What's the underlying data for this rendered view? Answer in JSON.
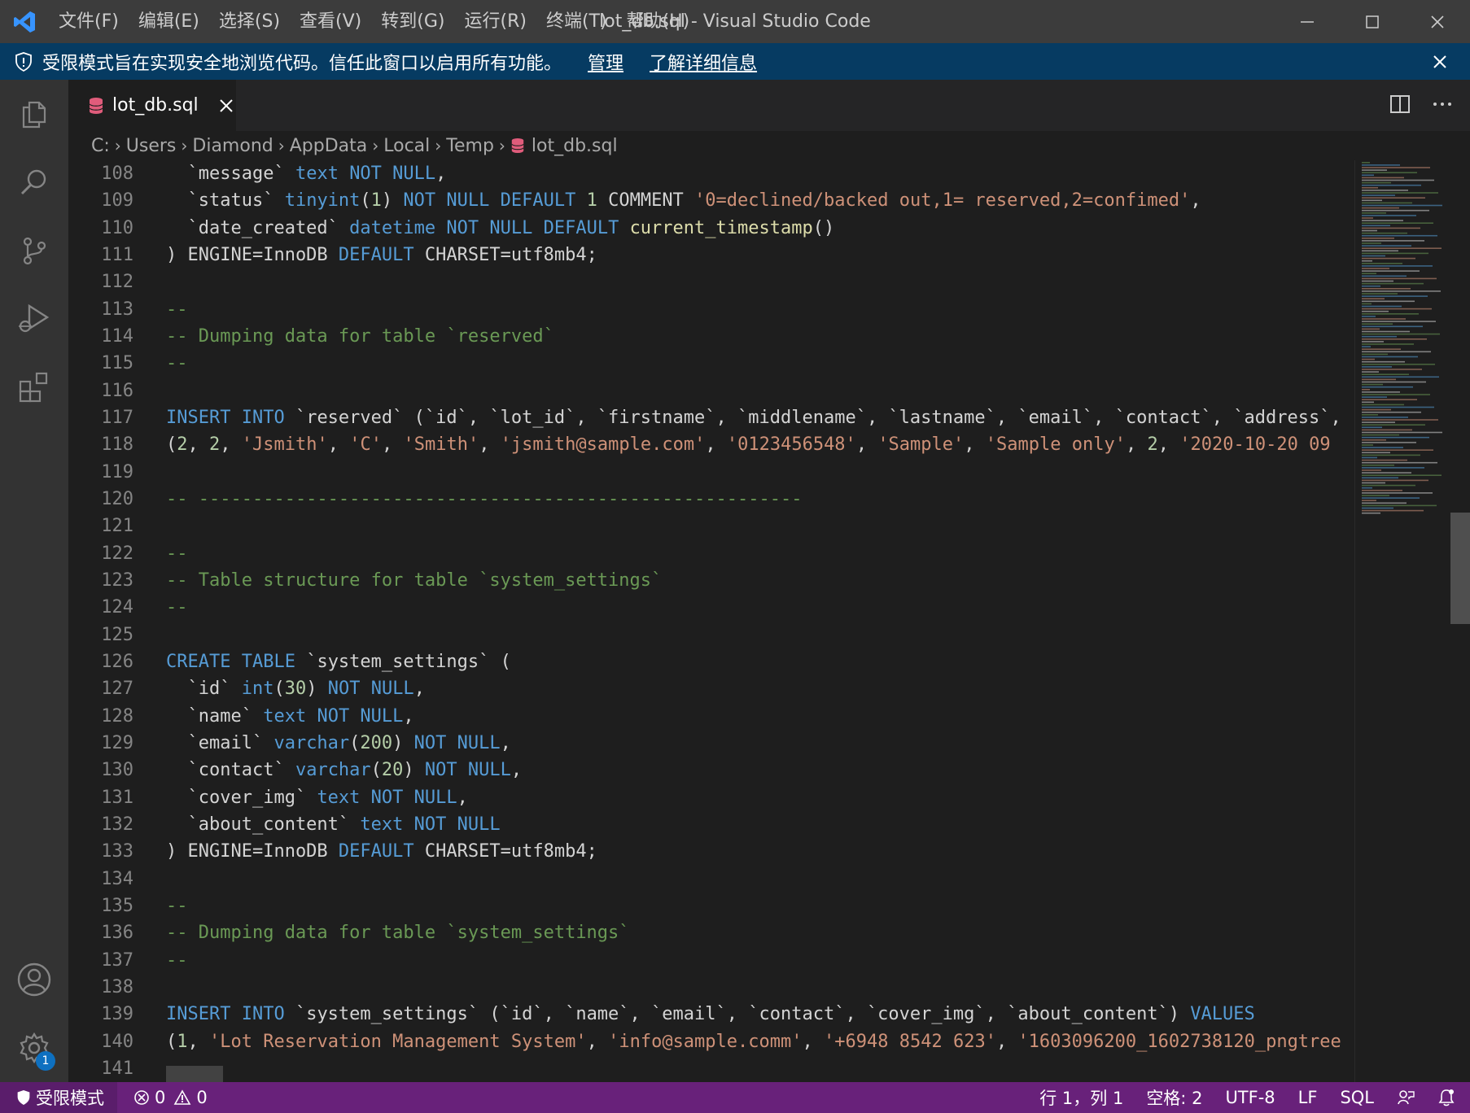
{
  "window": {
    "title": "lot_db.sql - Visual Studio Code",
    "menu": [
      "文件(F)",
      "编辑(E)",
      "选择(S)",
      "查看(V)",
      "转到(G)",
      "运行(R)",
      "终端(T)",
      "帮助(H)"
    ]
  },
  "banner": {
    "text": "受限模式旨在实现安全地浏览代码。信任此窗口以启用所有功能。",
    "manage_link": "管理",
    "learn_more_link": "了解详细信息"
  },
  "tab": {
    "label": "lot_db.sql"
  },
  "breadcrumb": [
    "C:",
    "Users",
    "Diamond",
    "AppData",
    "Local",
    "Temp",
    "lot_db.sql"
  ],
  "editor": {
    "lines": [
      {
        "n": "108",
        "t": [
          [
            "plain",
            "  `message` "
          ],
          [
            "kw",
            "text"
          ],
          [
            "plain",
            " "
          ],
          [
            "kw",
            "NOT NULL"
          ],
          [
            "plain",
            ","
          ]
        ]
      },
      {
        "n": "109",
        "t": [
          [
            "plain",
            "  `status` "
          ],
          [
            "kw",
            "tinyint"
          ],
          [
            "plain",
            "("
          ],
          [
            "num",
            "1"
          ],
          [
            "plain",
            ") "
          ],
          [
            "kw",
            "NOT NULL DEFAULT"
          ],
          [
            "plain",
            " "
          ],
          [
            "num",
            "1"
          ],
          [
            "plain",
            " COMMENT "
          ],
          [
            "str",
            "'0=declined/backed out,1= reserved,2=confimed'"
          ],
          [
            "plain",
            ","
          ]
        ]
      },
      {
        "n": "110",
        "t": [
          [
            "plain",
            "  `date_created` "
          ],
          [
            "kw",
            "datetime"
          ],
          [
            "plain",
            " "
          ],
          [
            "kw",
            "NOT NULL DEFAULT"
          ],
          [
            "plain",
            " "
          ],
          [
            "fn",
            "current_timestamp"
          ],
          [
            "plain",
            "()"
          ]
        ]
      },
      {
        "n": "111",
        "t": [
          [
            "plain",
            ") ENGINE=InnoDB "
          ],
          [
            "kw",
            "DEFAULT"
          ],
          [
            "plain",
            " CHARSET=utf8mb4;"
          ]
        ]
      },
      {
        "n": "112",
        "t": []
      },
      {
        "n": "113",
        "t": [
          [
            "cmt",
            "--"
          ]
        ]
      },
      {
        "n": "114",
        "t": [
          [
            "cmt",
            "-- Dumping data for table `reserved`"
          ]
        ]
      },
      {
        "n": "115",
        "t": [
          [
            "cmt",
            "--"
          ]
        ]
      },
      {
        "n": "116",
        "t": []
      },
      {
        "n": "117",
        "t": [
          [
            "kw",
            "INSERT INTO"
          ],
          [
            "plain",
            " `reserved` (`id`, `lot_id`, `firstname`, `middlename`, `lastname`, `email`, `contact`, `address`, "
          ]
        ]
      },
      {
        "n": "118",
        "t": [
          [
            "plain",
            "("
          ],
          [
            "num",
            "2"
          ],
          [
            "plain",
            ", "
          ],
          [
            "num",
            "2"
          ],
          [
            "plain",
            ", "
          ],
          [
            "str",
            "'Jsmith'"
          ],
          [
            "plain",
            ", "
          ],
          [
            "str",
            "'C'"
          ],
          [
            "plain",
            ", "
          ],
          [
            "str",
            "'Smith'"
          ],
          [
            "plain",
            ", "
          ],
          [
            "str",
            "'jsmith@sample.com'"
          ],
          [
            "plain",
            ", "
          ],
          [
            "str",
            "'0123456548'"
          ],
          [
            "plain",
            ", "
          ],
          [
            "str",
            "'Sample'"
          ],
          [
            "plain",
            ", "
          ],
          [
            "str",
            "'Sample only'"
          ],
          [
            "plain",
            ", "
          ],
          [
            "num",
            "2"
          ],
          [
            "plain",
            ", "
          ],
          [
            "str",
            "'2020-10-20 09"
          ]
        ]
      },
      {
        "n": "119",
        "t": []
      },
      {
        "n": "120",
        "t": [
          [
            "cmt",
            "-- --------------------------------------------------------"
          ]
        ]
      },
      {
        "n": "121",
        "t": []
      },
      {
        "n": "122",
        "t": [
          [
            "cmt",
            "--"
          ]
        ]
      },
      {
        "n": "123",
        "t": [
          [
            "cmt",
            "-- Table structure for table `system_settings`"
          ]
        ]
      },
      {
        "n": "124",
        "t": [
          [
            "cmt",
            "--"
          ]
        ]
      },
      {
        "n": "125",
        "t": []
      },
      {
        "n": "126",
        "t": [
          [
            "kw",
            "CREATE TABLE"
          ],
          [
            "plain",
            " `system_settings` ("
          ]
        ]
      },
      {
        "n": "127",
        "t": [
          [
            "plain",
            "  `id` "
          ],
          [
            "kw",
            "int"
          ],
          [
            "plain",
            "("
          ],
          [
            "num",
            "30"
          ],
          [
            "plain",
            ") "
          ],
          [
            "kw",
            "NOT NULL"
          ],
          [
            "plain",
            ","
          ]
        ]
      },
      {
        "n": "128",
        "t": [
          [
            "plain",
            "  `name` "
          ],
          [
            "kw",
            "text"
          ],
          [
            "plain",
            " "
          ],
          [
            "kw",
            "NOT NULL"
          ],
          [
            "plain",
            ","
          ]
        ]
      },
      {
        "n": "129",
        "t": [
          [
            "plain",
            "  `email` "
          ],
          [
            "kw",
            "varchar"
          ],
          [
            "plain",
            "("
          ],
          [
            "num",
            "200"
          ],
          [
            "plain",
            ") "
          ],
          [
            "kw",
            "NOT NULL"
          ],
          [
            "plain",
            ","
          ]
        ]
      },
      {
        "n": "130",
        "t": [
          [
            "plain",
            "  `contact` "
          ],
          [
            "kw",
            "varchar"
          ],
          [
            "plain",
            "("
          ],
          [
            "num",
            "20"
          ],
          [
            "plain",
            ") "
          ],
          [
            "kw",
            "NOT NULL"
          ],
          [
            "plain",
            ","
          ]
        ]
      },
      {
        "n": "131",
        "t": [
          [
            "plain",
            "  `cover_img` "
          ],
          [
            "kw",
            "text"
          ],
          [
            "plain",
            " "
          ],
          [
            "kw",
            "NOT NULL"
          ],
          [
            "plain",
            ","
          ]
        ]
      },
      {
        "n": "132",
        "t": [
          [
            "plain",
            "  `about_content` "
          ],
          [
            "kw",
            "text"
          ],
          [
            "plain",
            " "
          ],
          [
            "kw",
            "NOT NULL"
          ]
        ]
      },
      {
        "n": "133",
        "t": [
          [
            "plain",
            ") ENGINE=InnoDB "
          ],
          [
            "kw",
            "DEFAULT"
          ],
          [
            "plain",
            " CHARSET=utf8mb4;"
          ]
        ]
      },
      {
        "n": "134",
        "t": []
      },
      {
        "n": "135",
        "t": [
          [
            "cmt",
            "--"
          ]
        ]
      },
      {
        "n": "136",
        "t": [
          [
            "cmt",
            "-- Dumping data for table `system_settings`"
          ]
        ]
      },
      {
        "n": "137",
        "t": [
          [
            "cmt",
            "--"
          ]
        ]
      },
      {
        "n": "138",
        "t": []
      },
      {
        "n": "139",
        "t": [
          [
            "kw",
            "INSERT INTO"
          ],
          [
            "plain",
            " `system_settings` (`id`, `name`, `email`, `contact`, `cover_img`, `about_content`) "
          ],
          [
            "kw",
            "VALUES"
          ]
        ]
      },
      {
        "n": "140",
        "t": [
          [
            "plain",
            "("
          ],
          [
            "num",
            "1"
          ],
          [
            "plain",
            ", "
          ],
          [
            "str",
            "'Lot Reservation Management System'"
          ],
          [
            "plain",
            ", "
          ],
          [
            "str",
            "'info@sample.comm'"
          ],
          [
            "plain",
            ", "
          ],
          [
            "str",
            "'+6948 8542 623'"
          ],
          [
            "plain",
            ", "
          ],
          [
            "str",
            "'1603096200_1602738120_pngtree"
          ]
        ]
      },
      {
        "n": "141",
        "t": []
      }
    ]
  },
  "statusbar": {
    "restricted": "受限模式",
    "errors": "0",
    "warnings": "0",
    "position": "行 1，列 1",
    "indent": "空格: 2",
    "encoding": "UTF-8",
    "eol": "LF",
    "language": "SQL"
  },
  "activity": {
    "accounts_badge": "1"
  },
  "colors": {
    "titlebar": "#3c3c3c",
    "banner": "#063b62",
    "statusbar": "#68217a",
    "editor_bg": "#1e1e1e",
    "keyword": "#569cd6",
    "string": "#ce9178",
    "comment": "#6a9955",
    "number": "#b5cea8",
    "function": "#dcdcaa"
  },
  "icons": [
    "vscode-logo-icon",
    "shield-icon",
    "files-icon",
    "search-icon",
    "source-control-icon",
    "run-debug-icon",
    "extensions-icon",
    "account-icon",
    "gear-icon",
    "database-icon",
    "split-editor-icon",
    "more-icon",
    "close-icon",
    "error-icon",
    "warning-icon",
    "feedback-icon",
    "bell-icon"
  ]
}
